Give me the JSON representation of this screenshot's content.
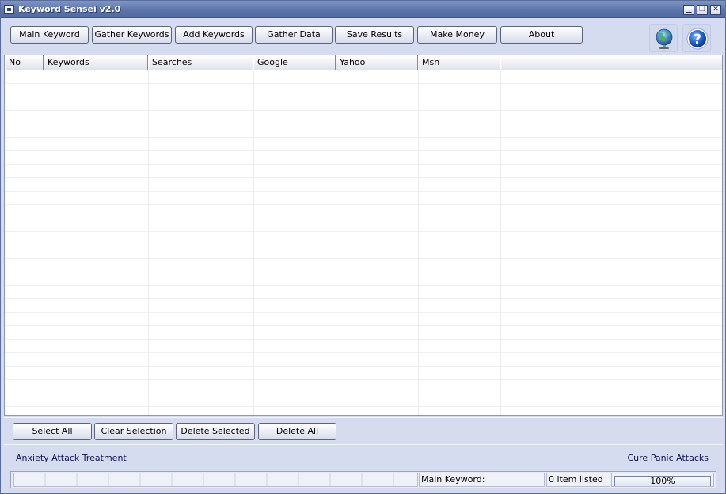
{
  "window": {
    "title": "Keyword Sensei v2.0"
  },
  "toolbar": {
    "buttons": [
      {
        "label": "Main Keyword"
      },
      {
        "label": "Gather Keywords"
      },
      {
        "label": "Add Keywords"
      },
      {
        "label": "Gather Data"
      },
      {
        "label": "Save Results"
      },
      {
        "label": "Make Money"
      },
      {
        "label": "About"
      }
    ],
    "icons": [
      "globe-icon",
      "help-icon"
    ]
  },
  "grid": {
    "columns": [
      "No",
      "Keywords",
      "Searches",
      "Google",
      "Yahoo",
      "Msn"
    ],
    "rows": []
  },
  "actions": {
    "select_all": "Select All",
    "clear_selection": "Clear Selection",
    "delete_selected": "Delete Selected",
    "delete_all": "Delete All"
  },
  "links": {
    "left": "Anxiety Attack Treatment",
    "right": "Cure Panic Attacks"
  },
  "status": {
    "main_keyword_label": "Main Keyword:",
    "item_count": "0 item listed",
    "progress_text": "100%",
    "progress_value": 100
  },
  "colors": {
    "title_bar": "#5b73aa",
    "background": "#d6dcef"
  }
}
